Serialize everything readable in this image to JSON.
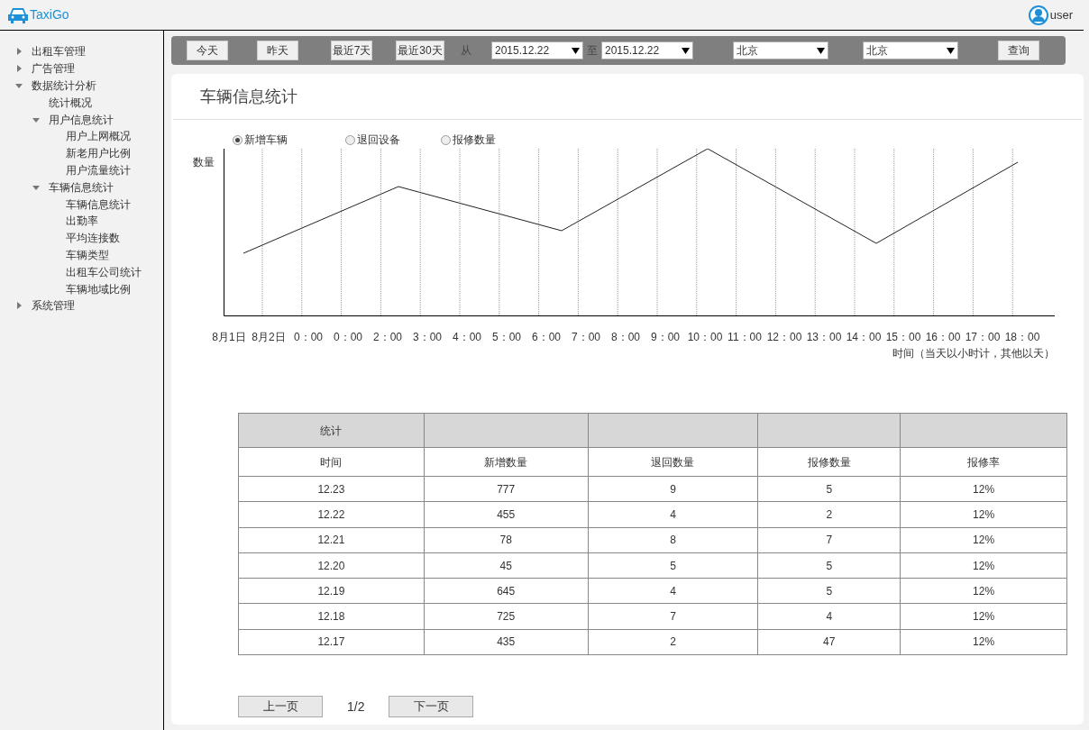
{
  "header": {
    "logo": "TaxiGo",
    "user": "user"
  },
  "sidebar": {
    "items": [
      {
        "label": "出租车管理",
        "expanded": false
      },
      {
        "label": "广告管理",
        "expanded": false
      },
      {
        "label": "数据统计分析",
        "expanded": true,
        "children": [
          {
            "label": "统计概况"
          },
          {
            "label": "用户信息统计",
            "expanded": true,
            "children": [
              {
                "label": "用户上网概况"
              },
              {
                "label": "新老用户比例"
              },
              {
                "label": "用户流量统计"
              }
            ]
          },
          {
            "label": "车辆信息统计",
            "expanded": true,
            "children": [
              {
                "label": "车辆信息统计"
              },
              {
                "label": "出勤率"
              },
              {
                "label": "平均连接数"
              },
              {
                "label": "车辆类型"
              },
              {
                "label": "出租车公司统计"
              },
              {
                "label": "车辆地域比例"
              }
            ]
          }
        ]
      },
      {
        "label": "系统管理",
        "expanded": false
      }
    ]
  },
  "toolbar": {
    "buttons": [
      "今天",
      "昨天",
      "最近7天",
      "最近30天"
    ],
    "from_label": "从",
    "from_date": "2015.12.22",
    "to_label": "至",
    "to_date": "2015.12.22",
    "city_1": "北京",
    "city_2": "北京",
    "query": "查询"
  },
  "panel": {
    "title": "车辆信息统计",
    "radios": [
      {
        "label": "新增车辆",
        "selected": true
      },
      {
        "label": "退回设备",
        "selected": false
      },
      {
        "label": "报修数量",
        "selected": false
      }
    ],
    "chart": {
      "ylabel": "数量",
      "xlabel": "时间（当天以小时计，其他以天）",
      "categories": [
        "8月1日",
        "8月2日",
        "0：00",
        "0：00",
        "2：00",
        "3：00",
        "4：00",
        "5：00",
        "6：00",
        "7：00",
        "8：00",
        "9：00",
        "10：00",
        "11：00",
        "12：00",
        "13：00",
        "14：00",
        "15：00",
        "16：00",
        "17：00",
        "18：00"
      ]
    },
    "table": {
      "group_header": "统计",
      "columns": [
        "时间",
        "新增数量",
        "退回数量",
        "报修数量",
        "报修率"
      ],
      "rows": [
        [
          "12.23",
          "777",
          "9",
          "5",
          "12%"
        ],
        [
          "12.22",
          "455",
          "4",
          "2",
          "12%"
        ],
        [
          "12.21",
          "78",
          "8",
          "7",
          "12%"
        ],
        [
          "12.20",
          "45",
          "5",
          "5",
          "12%"
        ],
        [
          "12.19",
          "645",
          "4",
          "5",
          "12%"
        ],
        [
          "12.18",
          "725",
          "7",
          "4",
          "12%"
        ],
        [
          "12.17",
          "435",
          "2",
          "47",
          "12%"
        ]
      ]
    },
    "pagination": {
      "prev": "上一页",
      "page": "1/2",
      "next": "下一页"
    }
  }
}
